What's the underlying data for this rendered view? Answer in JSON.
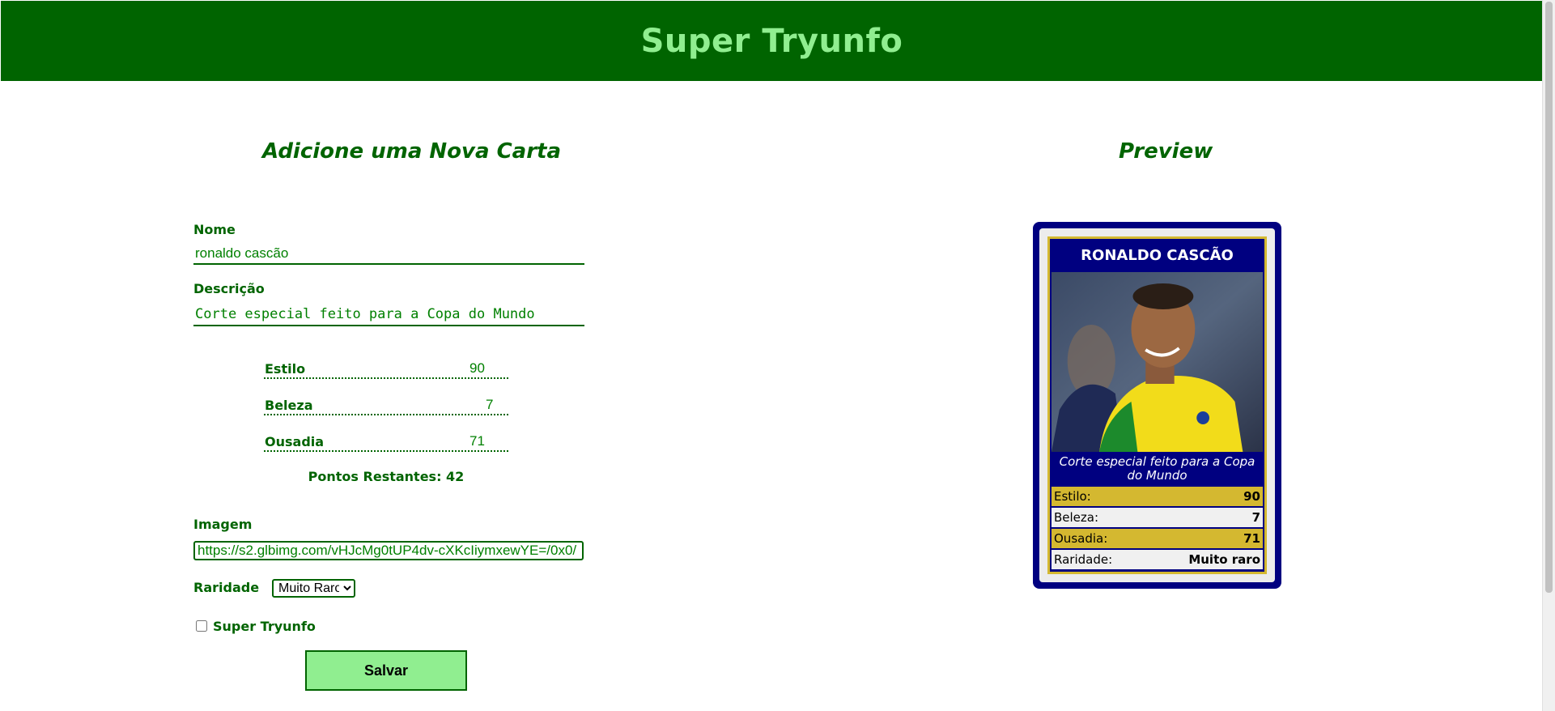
{
  "header": {
    "title": "Super Tryunfo"
  },
  "form": {
    "title": "Adicione uma Nova Carta",
    "name_label": "Nome",
    "name_value": "ronaldo cascão",
    "description_label": "Descrição",
    "description_value": "Corte especial feito para a Copa do Mundo",
    "attributes": [
      {
        "label": "Estilo",
        "value": "90"
      },
      {
        "label": "Beleza",
        "value": "7"
      },
      {
        "label": "Ousadia",
        "value": "71"
      }
    ],
    "points_remaining": "Pontos Restantes: 42",
    "image_label": "Imagem",
    "image_value": "https://s2.glbimg.com/vHJcMg0tUP4dv-cXKcIiymxewYE=/0x0/",
    "rarity_label": "Raridade",
    "rarity_selected": "Muito Raro",
    "super_tryunfo_label": "Super Tryunfo",
    "super_tryunfo_checked": false,
    "save_label": "Salvar"
  },
  "preview": {
    "title": "Preview",
    "card_name": "RONALDO CASCÃO",
    "card_description": "Corte especial feito para a Copa do Mundo",
    "rows": [
      {
        "label": "Estilo:",
        "value": "90"
      },
      {
        "label": "Beleza:",
        "value": "7"
      },
      {
        "label": "Ousadia:",
        "value": "71"
      },
      {
        "label": "Raridade:",
        "value": "Muito raro"
      }
    ]
  },
  "colors": {
    "header_bg": "#006400",
    "header_text": "#90ee90",
    "accent_green": "#006400",
    "card_border": "#000080",
    "card_gold": "#d4b830",
    "button_bg": "#90ee90"
  }
}
